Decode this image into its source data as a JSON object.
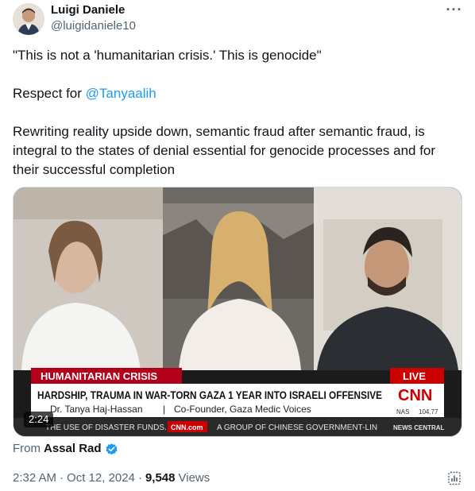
{
  "author": {
    "name": "Luigi Daniele",
    "handle": "@luigidaniele10",
    "avatar_icon": "avatar-photo"
  },
  "tweet": {
    "quote": "\"This is not a 'humanitarian crisis.' This is genocide\"",
    "respect_prefix": "Respect for ",
    "mention": "@Tanyaalih",
    "body": "Rewriting reality upside down, semantic fraud after semantic fraud, is integral to the states of denial essential for genocide processes and for their successful completion"
  },
  "media": {
    "duration": "2:24",
    "lower_third": {
      "tag": "HUMANITARIAN CRISIS",
      "live": "LIVE",
      "headline": "HARDSHIP, TRAUMA IN WAR-TORN GAZA 1 YEAR INTO ISRAELI OFFENSIVE",
      "guest": "Dr. Tanya Haj-Hassan",
      "separator": "|",
      "guest_title": "Co-Founder, Gaza Medic Voices",
      "logo": "CNN",
      "ticker_left": "THE USE OF DISASTER FUNDS.",
      "ticker_site": "CNN.com",
      "ticker_mid": "A GROUP OF CHINESE GOVERNMENT-LIN",
      "ticker_right": "NEWS CENTRAL",
      "nas": "NAS",
      "nas_value": "104.77"
    }
  },
  "footer": {
    "from_label": "From",
    "source_name": "Assal Rad",
    "time": "2:32 AM",
    "dot1": "·",
    "date": "Oct 12, 2024",
    "dot2": "·",
    "views": "9,548",
    "views_label": "Views"
  },
  "colors": {
    "mention": "#1d9bf0",
    "secondary_text": "#536471",
    "verified": "#1d9bf0",
    "cnn_red": "#cc0000"
  }
}
